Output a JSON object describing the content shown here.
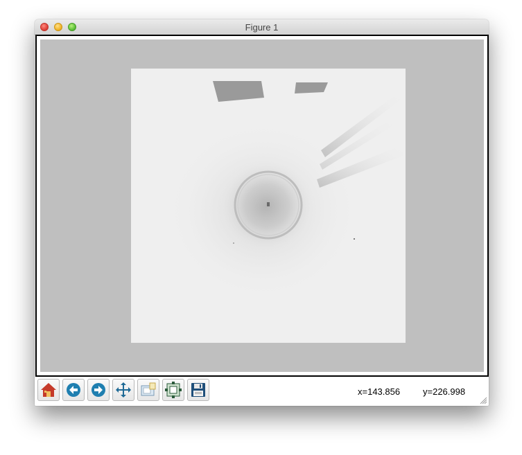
{
  "window": {
    "title": "Figure 1"
  },
  "toolbar": {
    "buttons": [
      {
        "id": "home",
        "icon": "home-icon"
      },
      {
        "id": "back",
        "icon": "arrow-left-icon"
      },
      {
        "id": "forward",
        "icon": "arrow-right-icon"
      },
      {
        "id": "pan",
        "icon": "move-arrows-icon"
      },
      {
        "id": "zoom",
        "icon": "zoom-rect-icon"
      },
      {
        "id": "subplots",
        "icon": "subplots-config-icon"
      },
      {
        "id": "save",
        "icon": "floppy-disk-icon"
      }
    ]
  },
  "status": {
    "x_readout": "x=143.856",
    "y_readout": "y=226.998"
  },
  "colors": {
    "figure_background": "#bfbfbf",
    "image_background": "#efefef",
    "toolbar_icon_blue": "#1f7fb0"
  }
}
